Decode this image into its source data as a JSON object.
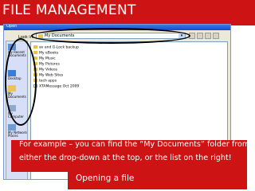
{
  "slide": {
    "title": "FILE MANAGEMENT",
    "caption": "For example – you can find the “My Documents” folder from either the drop-down at the top, or the list on the right!",
    "subtitle": "Opening a file"
  },
  "dialog": {
    "title": "Open",
    "look_in_label": "Look in:",
    "look_in_value": "My Documents",
    "places": [
      {
        "label": "My Recent Documents",
        "icon": "recent-documents-icon"
      },
      {
        "label": "Desktop",
        "icon": "desktop-icon"
      },
      {
        "label": "My Documents",
        "icon": "my-documents-icon"
      },
      {
        "label": "My Computer",
        "icon": "my-computer-icon"
      },
      {
        "label": "My Network Places",
        "icon": "network-places-icon"
      }
    ],
    "files": [
      "av and G-Lock backup",
      "My eBooks",
      "My Music",
      "My Pictures",
      "My Videos",
      "My Web Sites",
      "tech apps",
      "XTAMessage Oct 2009"
    ]
  },
  "colors": {
    "accent": "#cd1313",
    "text_on_accent": "#ffffff",
    "xp_title": "#0b4fd7",
    "dialog_bg": "#ece9d8"
  }
}
